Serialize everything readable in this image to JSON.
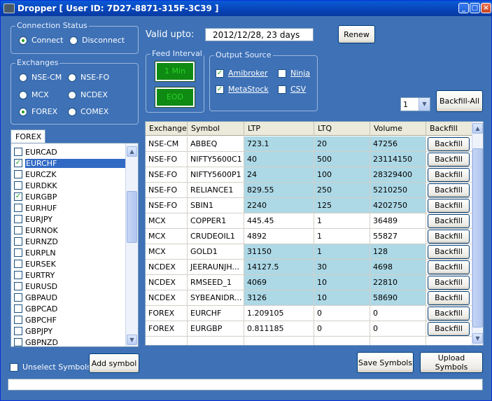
{
  "window": {
    "title": "Dropper [ User ID: 7D27-8871-315F-3C39 ]",
    "controls": {
      "minimize": "_",
      "maximize": "□",
      "close": "×"
    }
  },
  "connection": {
    "legend": "Connection Status",
    "options": [
      {
        "label": "Connect",
        "selected": true
      },
      {
        "label": "Disconnect",
        "selected": false
      }
    ]
  },
  "validity": {
    "label": "Valid upto:",
    "value": "2012/12/28,  23 days",
    "renew_label": "Renew"
  },
  "exchanges": {
    "legend": "Exchanges",
    "options": [
      {
        "label": "NSE-CM",
        "selected": false
      },
      {
        "label": "NSE-FO",
        "selected": false
      },
      {
        "label": "MCX",
        "selected": false
      },
      {
        "label": "NCDEX",
        "selected": false
      },
      {
        "label": "FOREX",
        "selected": true
      },
      {
        "label": "COMEX",
        "selected": false
      }
    ]
  },
  "feed_interval": {
    "legend": "Feed Interval",
    "buttons": [
      "1 Min",
      "EOD"
    ]
  },
  "output_source": {
    "legend": "Output Source",
    "options": [
      {
        "label": "Amibroker",
        "checked": true
      },
      {
        "label": "Ninja",
        "checked": false
      },
      {
        "label": "MetaStock",
        "checked": true
      },
      {
        "label": "CSV",
        "checked": false
      }
    ]
  },
  "backfill": {
    "days_value": "1",
    "backfill_all_label": "Backfill-All"
  },
  "symbols": {
    "tab_label": "FOREX",
    "items": [
      {
        "name": "EURCAD",
        "checked": false,
        "selected": false
      },
      {
        "name": "EURCHF",
        "checked": true,
        "selected": true
      },
      {
        "name": "EURCZK",
        "checked": false,
        "selected": false
      },
      {
        "name": "EURDKK",
        "checked": false,
        "selected": false
      },
      {
        "name": "EURGBP",
        "checked": true,
        "selected": false
      },
      {
        "name": "EURHUF",
        "checked": false,
        "selected": false
      },
      {
        "name": "EURJPY",
        "checked": false,
        "selected": false
      },
      {
        "name": "EURNOK",
        "checked": false,
        "selected": false
      },
      {
        "name": "EURNZD",
        "checked": false,
        "selected": false
      },
      {
        "name": "EURPLN",
        "checked": false,
        "selected": false
      },
      {
        "name": "EURSEK",
        "checked": false,
        "selected": false
      },
      {
        "name": "EURTRY",
        "checked": false,
        "selected": false
      },
      {
        "name": "EURUSD",
        "checked": false,
        "selected": false
      },
      {
        "name": "GBPAUD",
        "checked": false,
        "selected": false
      },
      {
        "name": "GBPCAD",
        "checked": false,
        "selected": false
      },
      {
        "name": "GBPCHF",
        "checked": false,
        "selected": false
      },
      {
        "name": "GBPJPY",
        "checked": false,
        "selected": false
      },
      {
        "name": "GBPNZD",
        "checked": false,
        "selected": false
      }
    ],
    "unselect_label": "Unselect Symbols",
    "add_label": "Add symbol"
  },
  "grid": {
    "columns": [
      "Exchange",
      "Symbol",
      "LTP",
      "LTQ",
      "Volume",
      "Backfill"
    ],
    "rows": [
      {
        "exchange": "NSE-CM",
        "symbol": "ABBEQ",
        "ltp": "723.1",
        "ltq": "20",
        "volume": "47256",
        "button": "Backfill",
        "highlight": true
      },
      {
        "exchange": "NSE-FO",
        "symbol": "NIFTY5600C1",
        "ltp": "40",
        "ltq": "500",
        "volume": "23114150",
        "button": "Backfill",
        "highlight": true
      },
      {
        "exchange": "NSE-FO",
        "symbol": "NIFTY5600P1",
        "ltp": "24",
        "ltq": "100",
        "volume": "28329400",
        "button": "Backfill",
        "highlight": true
      },
      {
        "exchange": "NSE-FO",
        "symbol": "RELIANCE1",
        "ltp": "829.55",
        "ltq": "250",
        "volume": "5210250",
        "button": "Backfill",
        "highlight": true
      },
      {
        "exchange": "NSE-FO",
        "symbol": "SBIN1",
        "ltp": "2240",
        "ltq": "125",
        "volume": "4202750",
        "button": "Backfill",
        "highlight": true
      },
      {
        "exchange": "MCX",
        "symbol": "COPPER1",
        "ltp": "445.45",
        "ltq": "1",
        "volume": "36489",
        "button": "Backfill",
        "highlight": false
      },
      {
        "exchange": "MCX",
        "symbol": "CRUDEOIL1",
        "ltp": "4892",
        "ltq": "1",
        "volume": "55827",
        "button": "Backfill",
        "highlight": false
      },
      {
        "exchange": "MCX",
        "symbol": "GOLD1",
        "ltp": "31150",
        "ltq": "1",
        "volume": "128",
        "button": "Backfill",
        "highlight": true
      },
      {
        "exchange": "NCDEX",
        "symbol": "JEERAUNJH...",
        "ltp": "14127.5",
        "ltq": "30",
        "volume": "4698",
        "button": "Backfill",
        "highlight": true
      },
      {
        "exchange": "NCDEX",
        "symbol": "RMSEED_1",
        "ltp": "4069",
        "ltq": "10",
        "volume": "22810",
        "button": "Backfill",
        "highlight": true
      },
      {
        "exchange": "NCDEX",
        "symbol": "SYBEANIDR...",
        "ltp": "3126",
        "ltq": "10",
        "volume": "58690",
        "button": "Backfill",
        "highlight": true
      },
      {
        "exchange": "FOREX",
        "symbol": "EURCHF",
        "ltp": "1.209105",
        "ltq": "0",
        "volume": "0",
        "button": "Backfill",
        "highlight": false
      },
      {
        "exchange": "FOREX",
        "symbol": "EURGBP",
        "ltp": "0.811185",
        "ltq": "0",
        "volume": "0",
        "button": "Backfill",
        "highlight": false
      }
    ]
  },
  "actions": {
    "save_label": "Save Symbols",
    "upload_label": "Upload Symbols"
  },
  "status": {
    "text": ""
  },
  "colors": {
    "background": "#3e71b6",
    "titlebar": "#0a5bd6",
    "row_highlight": "#add8e6",
    "feed_button": "#0f8a12",
    "selection": "#316ac5"
  }
}
